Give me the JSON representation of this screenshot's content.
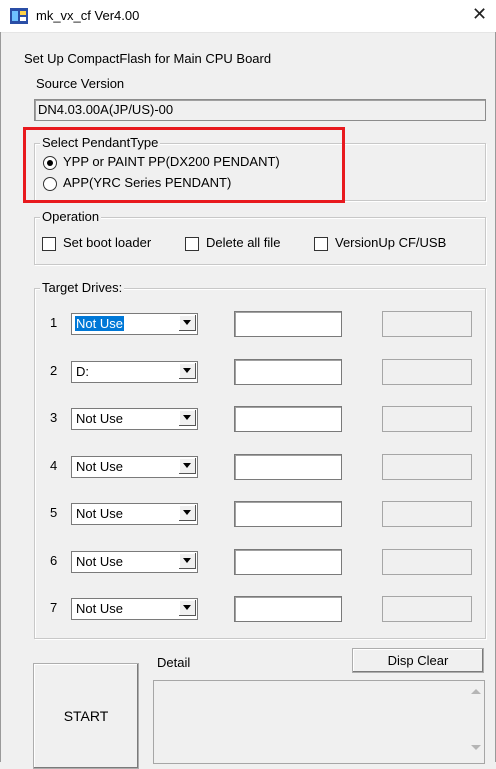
{
  "window": {
    "title": "mk_vx_cf Ver4.00",
    "close_glyph": "✕"
  },
  "header": {
    "subtitle": "Set Up CompactFlash for Main CPU Board"
  },
  "source": {
    "label": "Source Version",
    "value": "DN4.03.00A(JP/US)-00"
  },
  "pendant": {
    "group_label": "Select PendantType",
    "options": [
      {
        "label": "YPP or PAINT PP(DX200 PENDANT)",
        "selected": true
      },
      {
        "label": "APP(YRC Series PENDANT)",
        "selected": false
      }
    ]
  },
  "operation": {
    "group_label": "Operation",
    "checkboxes": [
      {
        "label": "Set boot loader",
        "checked": false
      },
      {
        "label": "Delete all file",
        "checked": false
      },
      {
        "label": "VersionUp CF/USB",
        "checked": false
      }
    ]
  },
  "target": {
    "group_label": "Target Drives:",
    "drives": [
      {
        "num": "1",
        "value": "Not Use",
        "selected": true
      },
      {
        "num": "2",
        "value": "D:",
        "selected": false
      },
      {
        "num": "3",
        "value": "Not Use",
        "selected": false
      },
      {
        "num": "4",
        "value": "Not Use",
        "selected": false
      },
      {
        "num": "5",
        "value": "Not Use",
        "selected": false
      },
      {
        "num": "6",
        "value": "Not Use",
        "selected": false
      },
      {
        "num": "7",
        "value": "Not Use",
        "selected": false
      }
    ]
  },
  "buttons": {
    "start": "START",
    "disp_clear": "Disp Clear"
  },
  "detail": {
    "label": "Detail"
  },
  "colors": {
    "highlight": "#e8191e",
    "selection": "#0078d7"
  }
}
